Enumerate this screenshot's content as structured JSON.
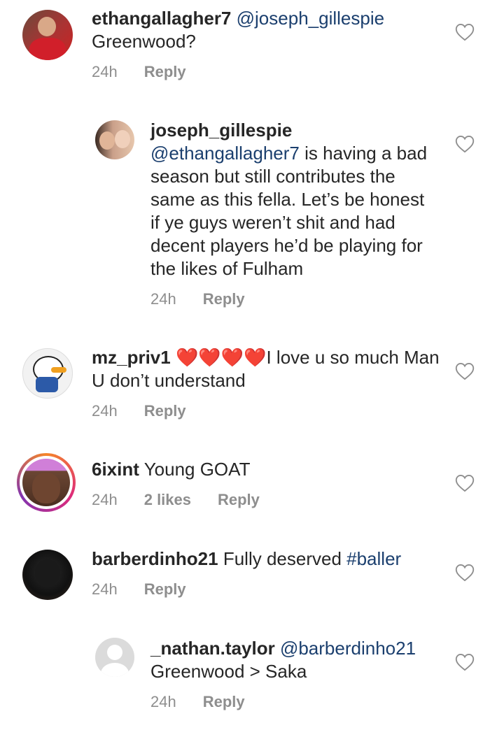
{
  "comments": [
    {
      "username": "ethangallagher7",
      "mention": "@joseph_gillespie",
      "text_after": "Greenwood?",
      "time": "24h",
      "reply": "Reply"
    },
    {
      "username": "joseph_gillespie",
      "mention": "@ethangallagher7",
      "text_after": "is having a bad season but still contributes the same as this fella. Let’s be honest if ye guys weren’t shit and had decent players he’d be playing for the likes of Fulham",
      "time": "24h",
      "reply": "Reply"
    },
    {
      "username": "mz_priv1",
      "emojis": "❤️❤️❤️❤️",
      "text_after": "I love u so much Man U don’t understand",
      "time": "24h",
      "reply": "Reply"
    },
    {
      "username": "6ixint",
      "text": "Young GOAT",
      "time": "24h",
      "likes": "2 likes",
      "reply": "Reply"
    },
    {
      "username": "barberdinho21",
      "text": "Fully deserved",
      "hashtag": "#baller",
      "time": "24h",
      "reply": "Reply"
    },
    {
      "username": "_nathan.taylor",
      "mention": "@barberdinho21",
      "text_after": "Greenwood > Saka",
      "time": "24h",
      "reply": "Reply"
    }
  ],
  "colors": {
    "text": "#262626",
    "meta": "#8e8e8e",
    "link": "#1b3f6e",
    "heart_emoji": "#e0102a"
  },
  "icons": [
    "heart-outline-icon"
  ]
}
